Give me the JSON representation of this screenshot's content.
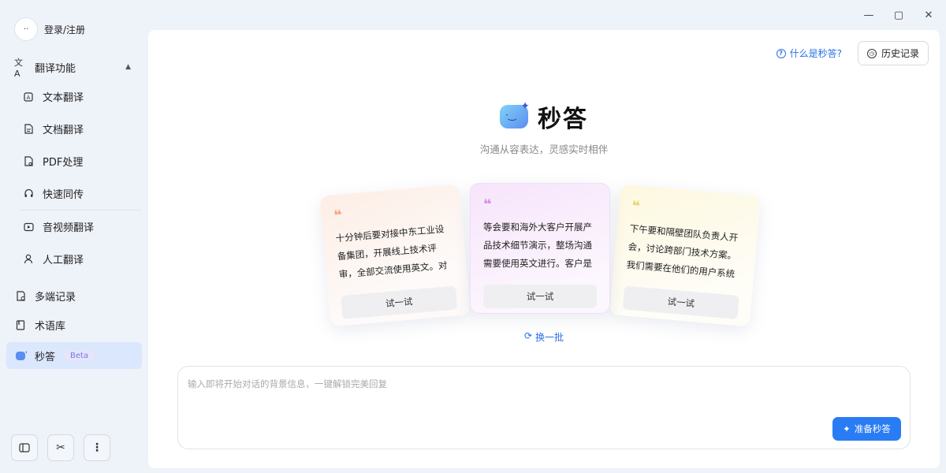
{
  "window": {
    "minimize": "—",
    "maximize": "▢",
    "close": "✕"
  },
  "user": {
    "avatar_glyph": "··",
    "label": "登录/注册"
  },
  "nav": {
    "translate_group": "翻译功能",
    "items": [
      {
        "label": "文本翻译",
        "icon": "text-translate-icon"
      },
      {
        "label": "文档翻译",
        "icon": "doc-translate-icon"
      },
      {
        "label": "PDF处理",
        "icon": "pdf-icon"
      },
      {
        "label": "快速同传",
        "icon": "headset-icon"
      },
      {
        "label": "音视频翻译",
        "icon": "video-icon"
      },
      {
        "label": "人工翻译",
        "icon": "person-icon"
      }
    ],
    "records": "多端记录",
    "glossary": "术语库",
    "miaoda": "秒答",
    "beta": "Beta"
  },
  "main": {
    "what_link": "什么是秒答?",
    "history": "历史记录",
    "hero_title": "秒答",
    "subtitle": "沟通从容表达，灵感实时相伴",
    "cards": [
      {
        "text": "十分钟后要对接中东工业设备集团，开展线上技术评审，全部交流使用英文。对接人是…",
        "try": "试一试"
      },
      {
        "text": "等会要和海外大客户开展产品技术细节演示，整场沟通需要使用英文进行。客户是跨境…",
        "try": "试一试"
      },
      {
        "text": "下午要和隔壁团队负责人开会，讨论跨部门技术方案。我们需要在他们的用户系统基…",
        "try": "试一试"
      }
    ],
    "refresh": "换一批",
    "input_placeholder": "输入即将开始对话的背景信息，一键解锁完美回复",
    "go_button": "准备秒答"
  },
  "colors": {
    "accent": "#2a7cf4",
    "active_bg": "#dbe7fc",
    "page_bg": "#eef2f9"
  }
}
